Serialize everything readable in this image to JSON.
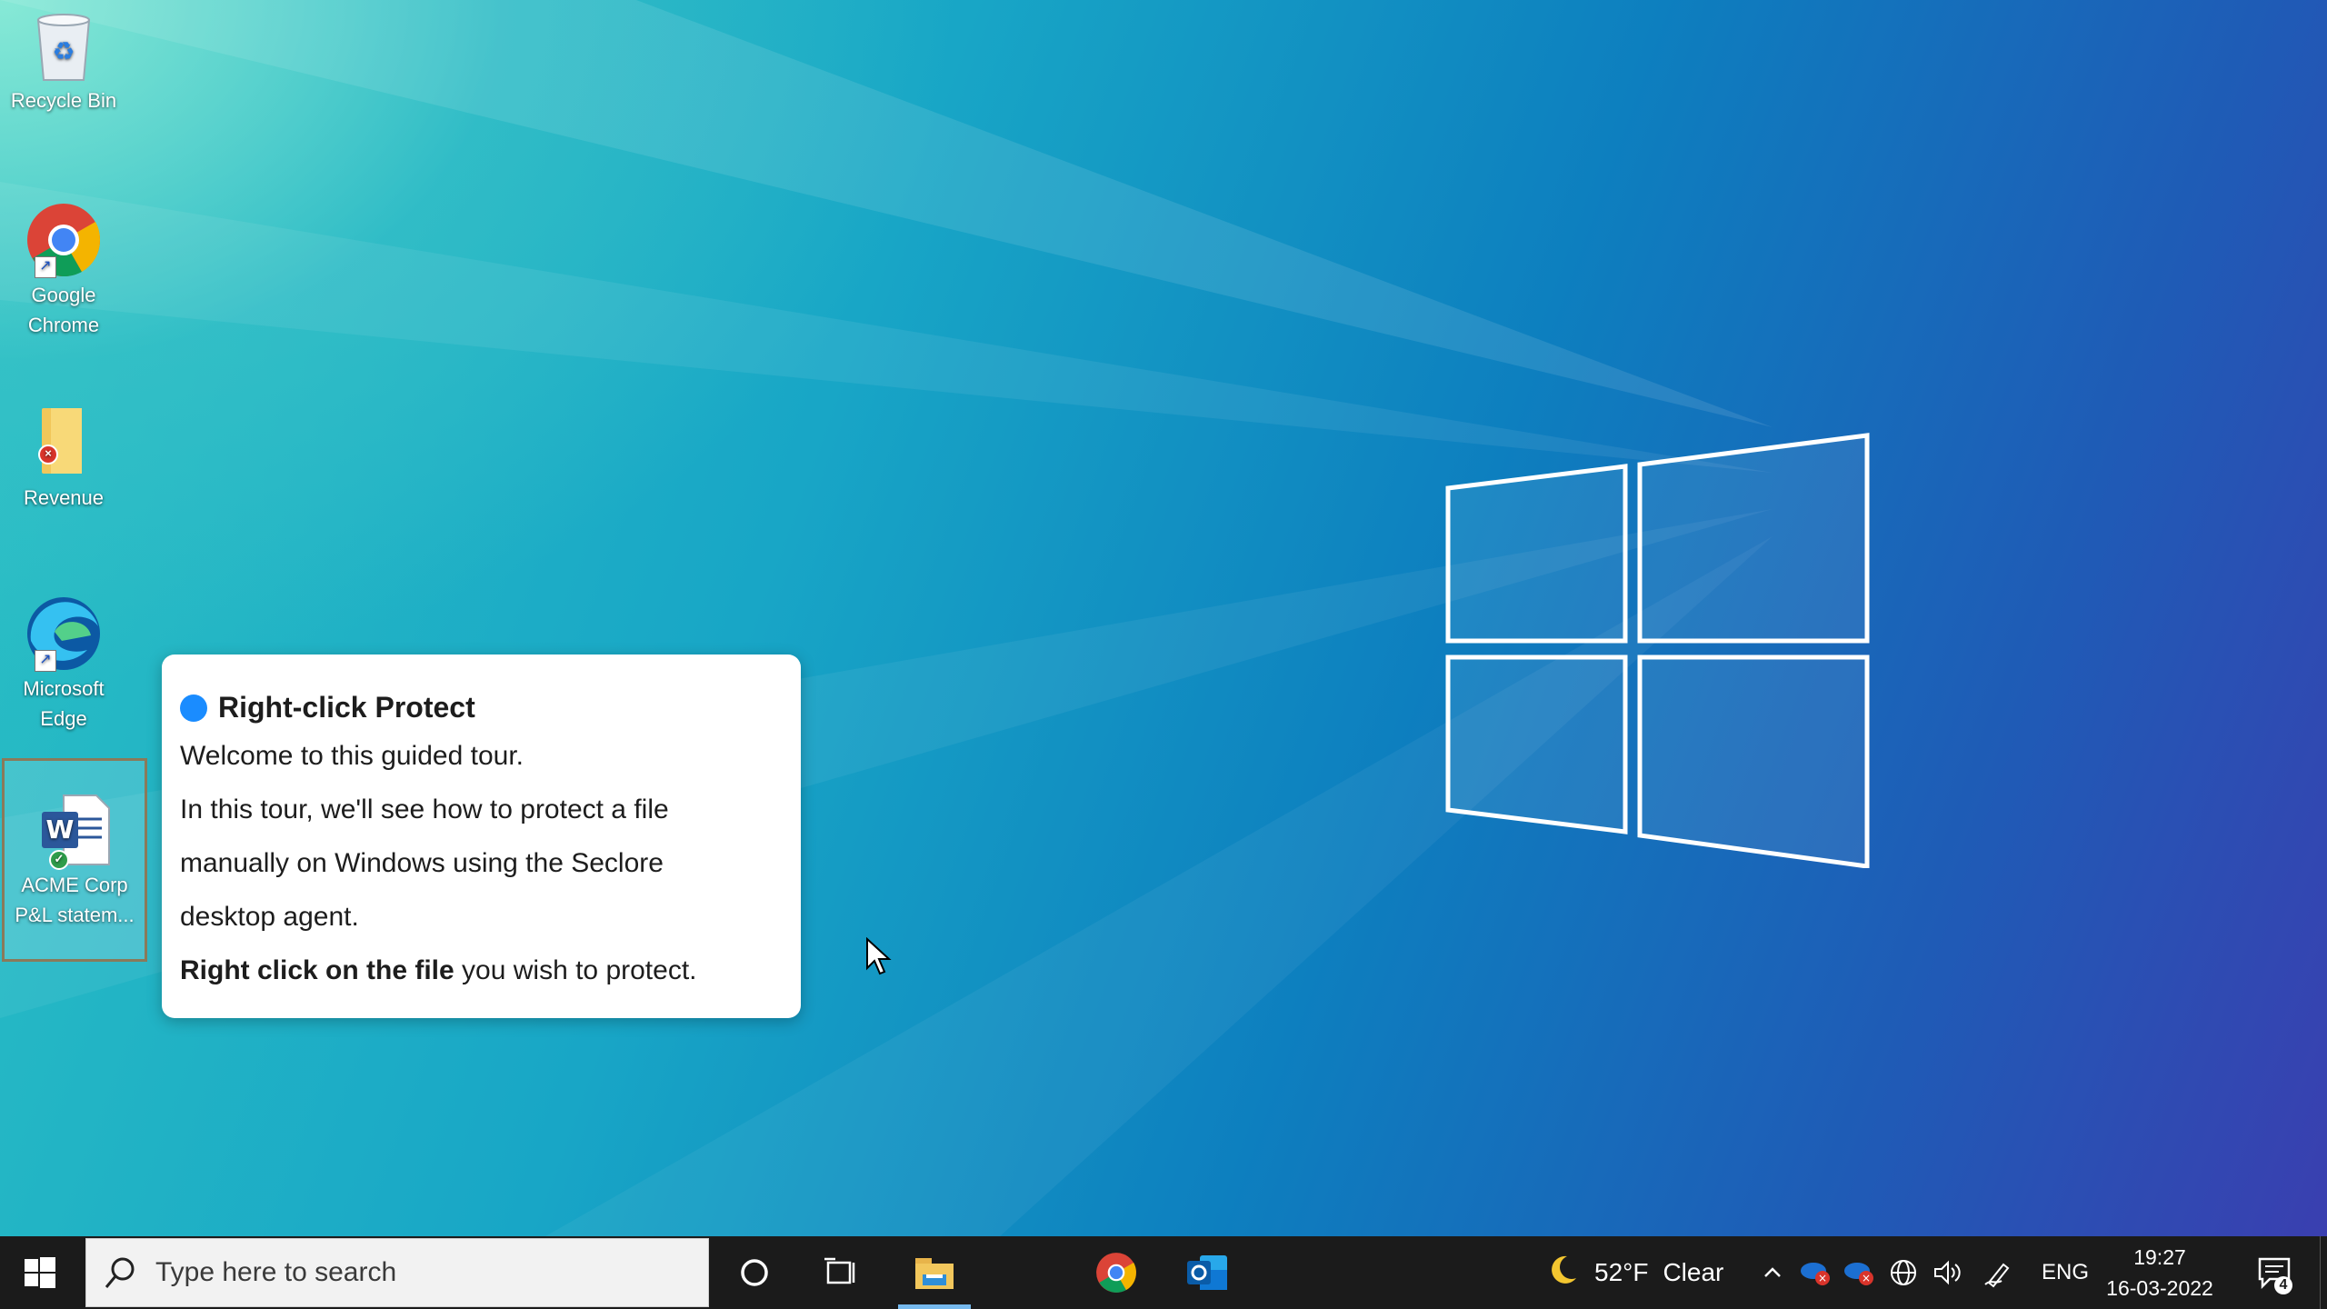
{
  "desktop": {
    "icons": [
      {
        "label": "Recycle Bin",
        "icon": "recycle-bin-icon"
      },
      {
        "label": "Google Chrome",
        "icon": "chrome-icon"
      },
      {
        "label": "Revenue",
        "icon": "folder-icon"
      },
      {
        "label": "Microsoft Edge",
        "icon": "edge-icon"
      },
      {
        "label": "ACME Corp P&L statem...",
        "icon": "word-document-icon"
      }
    ]
  },
  "tour": {
    "title": "Right-click Protect",
    "line1": "Welcome to this guided tour.",
    "line2": "In this tour, we'll see how to protect a file",
    "line3": "manually on Windows using the Seclore",
    "line4": "desktop agent.",
    "line5_bold": "Right click on the file",
    "line5_rest": " you wish to protect.",
    "dot_color": "#1a8cff"
  },
  "taskbar": {
    "search_placeholder": "Type here to search",
    "weather_temp": "52°F",
    "weather_condition": "Clear",
    "language": "ENG",
    "time": "19:27",
    "date": "16-03-2022",
    "notification_count": "4",
    "apps": [
      "file-explorer",
      "google-chrome",
      "outlook"
    ]
  },
  "colors": {
    "taskbar_bg": "#1b1b1b",
    "accent_underline": "#76b9ed"
  }
}
